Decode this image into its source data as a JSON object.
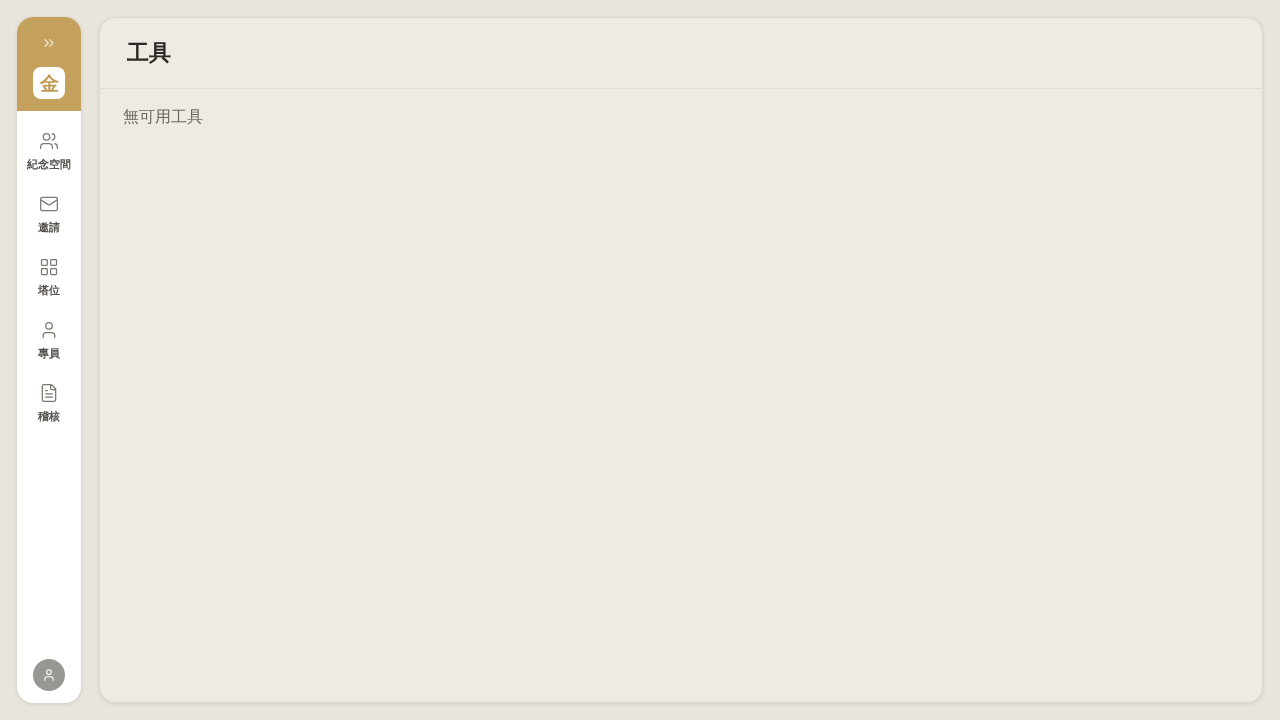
{
  "sidebar": {
    "logo": "金",
    "items": [
      {
        "label": "紀念空間"
      },
      {
        "label": "邀請"
      },
      {
        "label": "塔位"
      },
      {
        "label": "專員"
      },
      {
        "label": "稽核"
      }
    ]
  },
  "main": {
    "title": "工具",
    "empty_message": "無可用工具"
  }
}
